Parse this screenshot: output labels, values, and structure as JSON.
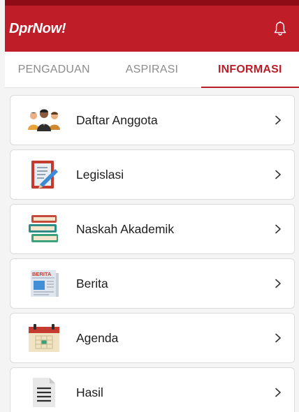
{
  "app": {
    "logo_text": "DprNow!",
    "brand_color": "#bf1d28",
    "notification_icon": "bell-icon"
  },
  "tabs": [
    {
      "label": "PENGADUAN",
      "active": false
    },
    {
      "label": "ASPIRASI",
      "active": false
    },
    {
      "label": "INFORMASI",
      "active": true
    }
  ],
  "menu": {
    "items": [
      {
        "label": "Daftar Anggota",
        "icon": "members-icon"
      },
      {
        "label": "Legislasi",
        "icon": "legislation-icon"
      },
      {
        "label": "Naskah Akademik",
        "icon": "books-icon"
      },
      {
        "label": "Berita",
        "icon": "newspaper-icon",
        "icon_text": "BERITA"
      },
      {
        "label": "Agenda",
        "icon": "calendar-icon"
      },
      {
        "label": "Hasil",
        "icon": "document-icon"
      }
    ]
  }
}
